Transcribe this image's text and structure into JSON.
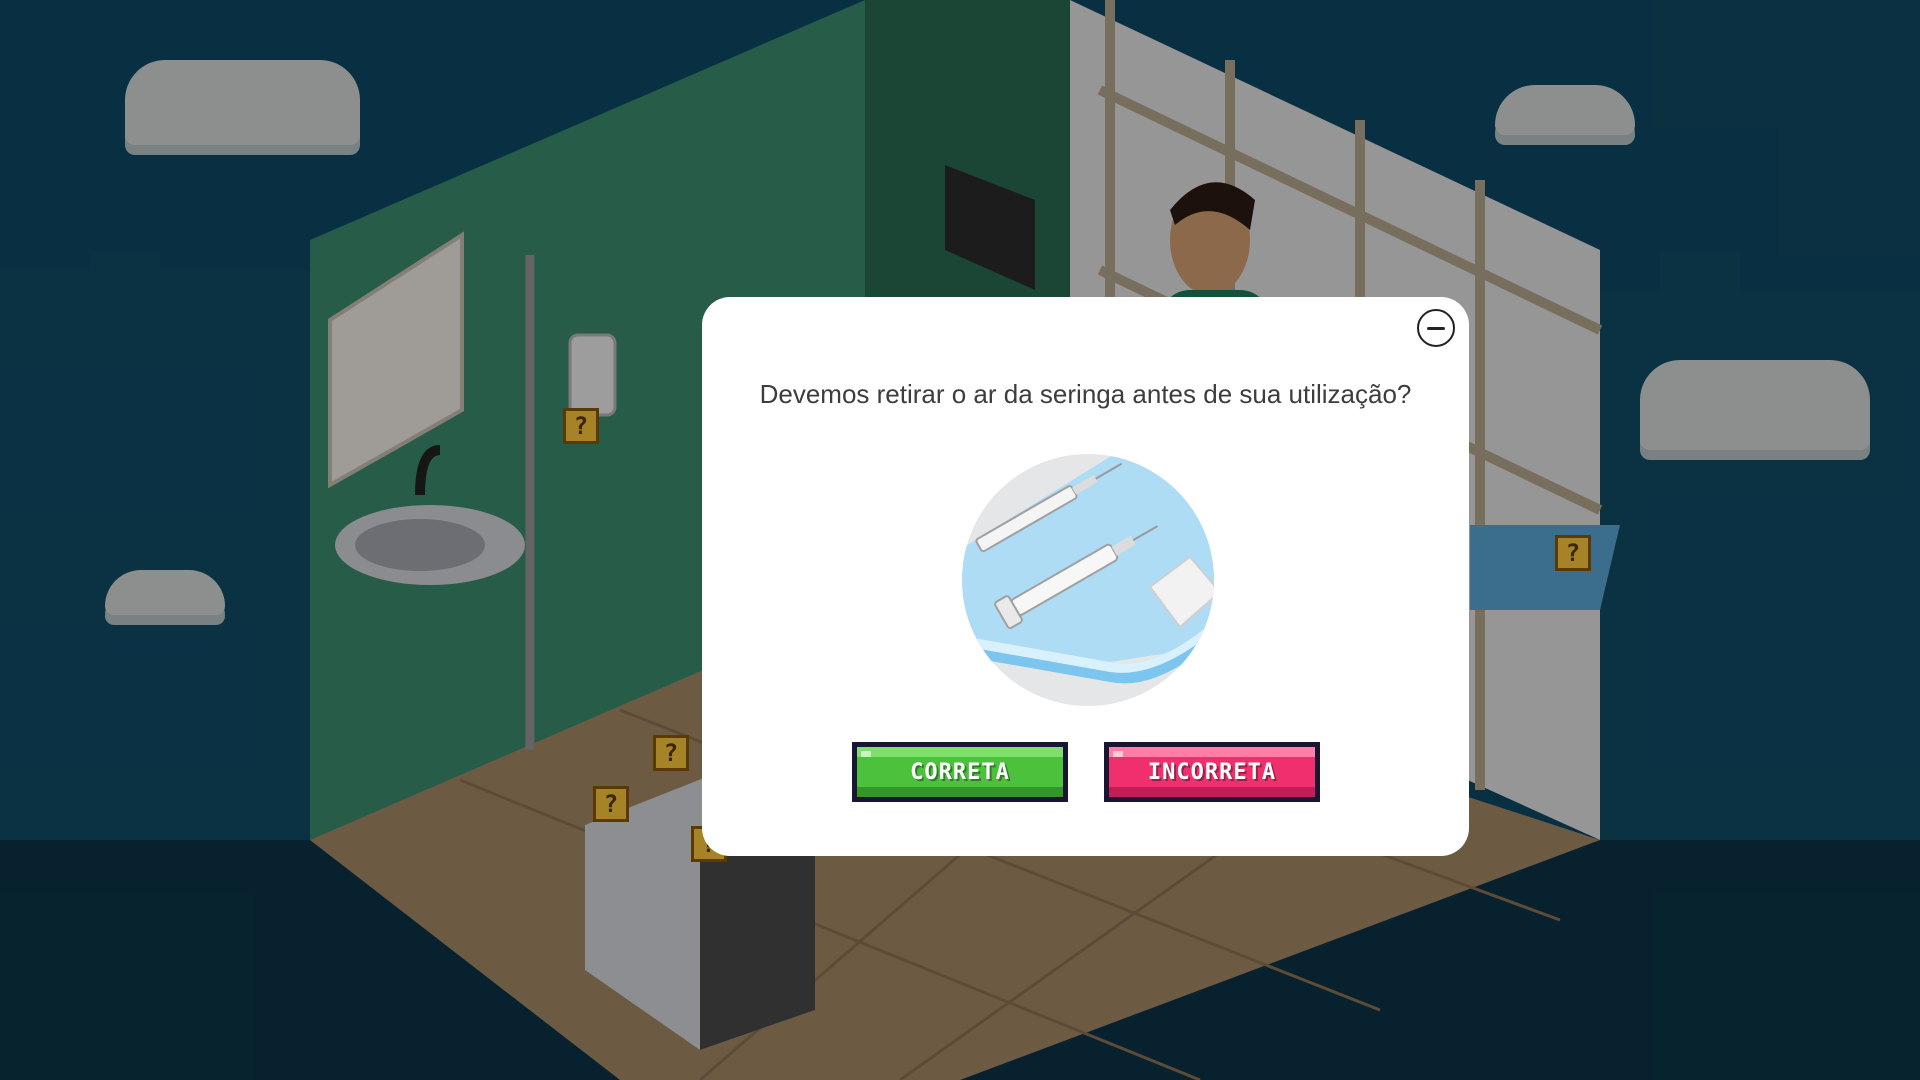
{
  "quiz": {
    "question": "Devemos retirar o ar da seringa antes de sua utilização?",
    "correct_label": "CORRETA",
    "incorrect_label": "INCORRETA"
  },
  "hint_markers": [
    "?",
    "?",
    "?",
    "?",
    "?"
  ],
  "icons": {
    "close": "minus-circle-icon",
    "illustration": "syringe-tray-illustration",
    "hint": "question-block-icon"
  },
  "colors": {
    "modal_bg": "#ffffff",
    "correct_button": "#4cc13c",
    "incorrect_button": "#f0306e",
    "sky": "#0f4a66"
  }
}
